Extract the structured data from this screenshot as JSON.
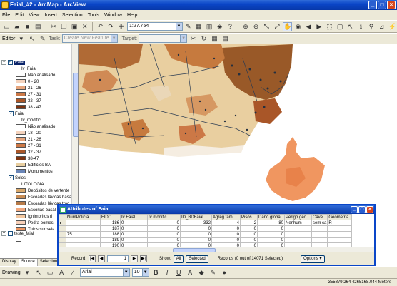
{
  "window": {
    "title": "Faial_#2 - ArcMap - ArcView"
  },
  "menu": [
    "File",
    "Edit",
    "View",
    "Insert",
    "Selection",
    "Tools",
    "Window",
    "Help"
  ],
  "toolbar": {
    "scale": "1:27.754"
  },
  "editor": {
    "label": "Editor",
    "task_label": "Task:",
    "task_value": "Create New Feature",
    "target_label": "Target:"
  },
  "toc": {
    "layers": [
      {
        "name": "Faial",
        "field": "Iv_Faial",
        "classes": [
          {
            "label": "Não analisado",
            "color": "#ffffff"
          },
          {
            "label": "0 - 20",
            "color": "#f5d3bd"
          },
          {
            "label": "21 - 26",
            "color": "#e7a57c"
          },
          {
            "label": "27 - 31",
            "color": "#cc7846"
          },
          {
            "label": "32 - 37",
            "color": "#a95628"
          },
          {
            "label": "38 - 47",
            "color": "#7d3411"
          }
        ]
      },
      {
        "name": "Faial",
        "field": "Iv_modific",
        "classes": [
          {
            "label": "Não analisado",
            "color": "#ffffff"
          },
          {
            "label": "18 - 20",
            "color": "#f5d3bd"
          },
          {
            "label": "21 - 26",
            "color": "#e7a57c"
          },
          {
            "label": "27 - 31",
            "color": "#cc7846"
          },
          {
            "label": "32 - 37",
            "color": "#a95628"
          },
          {
            "label": "38-47",
            "color": "#7d3411"
          }
        ]
      }
    ],
    "extra_items": [
      {
        "label": "Edificios BA"
      },
      {
        "label": "Monumentos"
      }
    ],
    "solos": {
      "name": "Solos",
      "field": "LITOLOGIA",
      "classes": [
        {
          "label": "Depósitos de vertente",
          "color": "#d8a86c"
        },
        {
          "label": "Escoadas lávicas basa",
          "color": "#c98d55"
        },
        {
          "label": "Escoadas lávicas traq",
          "color": "#b77a48"
        },
        {
          "label": "Escórias basál",
          "color": "#f2a87e"
        },
        {
          "label": "Ignimbritos ri",
          "color": "#f4c8a0"
        },
        {
          "label": "Pedra pomes",
          "color": "#f8d0b8"
        },
        {
          "label": "Tufos surtseia",
          "color": "#f09660"
        }
      ]
    },
    "teste": {
      "name": "teste_faial"
    },
    "tabs": [
      "Display",
      "Source",
      "Selection"
    ]
  },
  "attributes": {
    "title": "Attributes of Faial",
    "columns": [
      "NumPolicia",
      "FIDO",
      "Iv Faial",
      "Iv modific",
      "ID_BDFaial",
      "Agreg fam",
      "Pisos",
      "Dano globa",
      "Perigo geo",
      "Cave",
      "Geometria"
    ],
    "rows": [
      [
        "",
        "186",
        "0",
        "0",
        "332",
        "4",
        "2",
        "80",
        "Nenhum",
        "sem ca",
        "R"
      ],
      [
        "",
        "187",
        "0",
        "0",
        "0",
        "0",
        "0",
        "0",
        "",
        "",
        ""
      ],
      [
        "75",
        "188",
        "0",
        "0",
        "0",
        "0",
        "0",
        "0",
        "",
        "",
        ""
      ],
      [
        "",
        "189",
        "0",
        "0",
        "0",
        "0",
        "0",
        "0",
        "",
        "",
        ""
      ],
      [
        "",
        "190",
        "0",
        "0",
        "0",
        "0",
        "0",
        "0",
        "",
        "",
        ""
      ]
    ],
    "record_label": "Record:",
    "record_value": "1",
    "show_label": "Show:",
    "all_label": "All",
    "selected_label": "Selected",
    "records_info": "Records (0 out of 14071 Selected)",
    "options_label": "Options"
  },
  "draw": {
    "label": "Drawing",
    "font": "Arial",
    "size": "10"
  },
  "status": {
    "coords": "355879.264  4265168.044 Meters"
  },
  "colors": {
    "map_beige": "#e9cfa0",
    "map_orange": "#f09660",
    "map_rust": "#c67a3e",
    "map_dark": "#8b4413",
    "titlebar": "#0a46c8"
  }
}
